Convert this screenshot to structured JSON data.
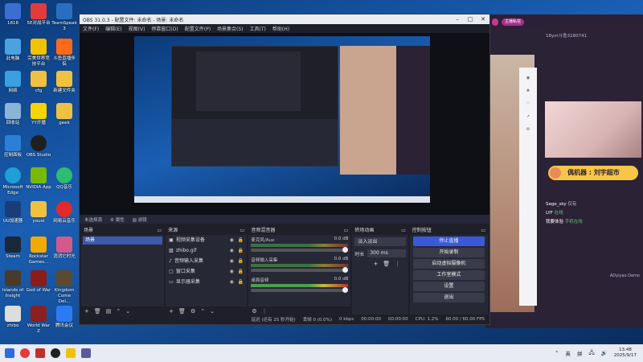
{
  "desktop": {
    "icons": [
      {
        "label": "1818"
      },
      {
        "label": "5E对战平台"
      },
      {
        "label": "TeamSpeak 3"
      },
      {
        "label": "此电脑"
      },
      {
        "label": "完美世界竞技平台"
      },
      {
        "label": "斗鱼直播伴侣"
      },
      {
        "label": "网络"
      },
      {
        "label": "cfg"
      },
      {
        "label": "新建文件夹"
      },
      {
        "label": "回收站"
      },
      {
        "label": "YY开播"
      },
      {
        "label": "geek"
      },
      {
        "label": "控制面板"
      },
      {
        "label": "OBS Studio"
      },
      {
        "label": "Microsoft Edge"
      },
      {
        "label": "NVIDIA App"
      },
      {
        "label": "QQ音乐"
      },
      {
        "label": "UU加速器"
      },
      {
        "label": "youxi"
      },
      {
        "label": "网易云音乐"
      },
      {
        "label": "Steam"
      },
      {
        "label": "Rockstar Games..."
      },
      {
        "label": "消消它时光"
      },
      {
        "label": "Islands of Insight"
      },
      {
        "label": "God of War"
      },
      {
        "label": "Kingdom Come Del..."
      },
      {
        "label": "zhibo"
      },
      {
        "label": "World War Z"
      },
      {
        "label": "腾讯会议"
      }
    ]
  },
  "obs": {
    "title": "OBS 31.0.3 - 配置文件: 未命名 - 场景: 未命名",
    "menu": [
      "文件(F)",
      "编辑(E)",
      "视图(V)",
      "停靠窗口(D)",
      "配置文件(P)",
      "场景集合(S)",
      "工具(T)",
      "帮助(H)"
    ],
    "preview_status": {
      "scene": "未选择源",
      "gear_label": "属性",
      "filter_label": "滤镜"
    },
    "scenes": {
      "header": "场景",
      "items": [
        "场景"
      ]
    },
    "sources": {
      "header": "来源",
      "items": [
        "视频采集设备",
        "zhibo.gif",
        "音频输入采集",
        "窗口采集",
        "显示器采集"
      ]
    },
    "mixer": {
      "header": "音频混音器",
      "channels": [
        {
          "name": "麦克风/Aux",
          "db": "0.0 dB"
        },
        {
          "name": "音频输入采集",
          "db": "0.0 dB"
        },
        {
          "name": "桌面音频",
          "db": "0.0 dB"
        }
      ]
    },
    "transitions": {
      "header": "转场动画",
      "selected": "淡入淡出",
      "duration_label": "时长",
      "duration_value": "300 ms"
    },
    "controls": {
      "header": "控制按钮",
      "buttons": [
        "停止直播",
        "开始录制",
        "启动虚拟摄像机",
        "工作室模式",
        "设置",
        "退出"
      ]
    },
    "status": {
      "delay": "延迟 (还有 25 秒开始)",
      "dropped": "丢帧 0 (0.0%)",
      "bitrate": "0 kbps",
      "time1": "00:00:00",
      "time2": "00:00:00",
      "cpu": "CPU: 1.2%",
      "fps": "60.00 / 60.00 FPS"
    }
  },
  "chat": {
    "tab_label": "主播私信",
    "user_label": "18ym斗鱼3180741",
    "lines": [
      {
        "user": "Sage_sky",
        "text": "仅有"
      },
      {
        "user": "LYF",
        "text": "在线"
      },
      {
        "user": "我要体验",
        "text": "手机在线"
      }
    ],
    "banner": "偶机器 : 刘宇超市",
    "footer": "ADyiyao Demo"
  },
  "taskbar": {
    "lang": "英",
    "ime": "拼",
    "time": "13:48",
    "date": "2025/9/17"
  }
}
